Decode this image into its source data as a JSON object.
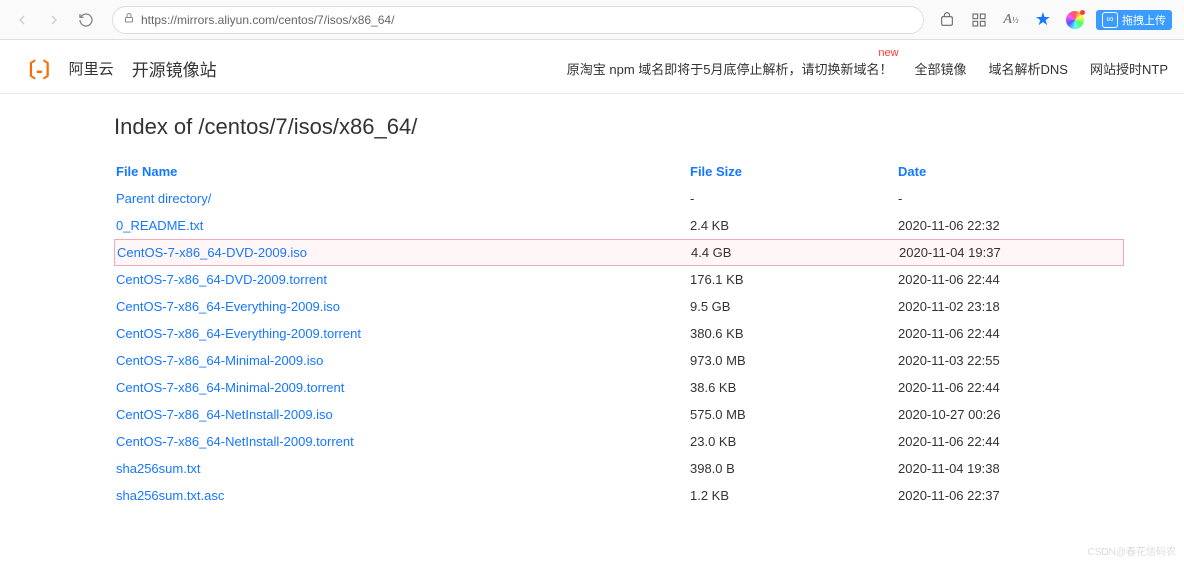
{
  "browser": {
    "url": "https://mirrors.aliyun.com/centos/7/isos/x86_64/",
    "ext_label": "拖拽上传"
  },
  "header": {
    "logo_text": "阿里云",
    "site_title": "开源镜像站",
    "notice": "原淘宝 npm 域名即将于5月底停止解析，请切换新域名！",
    "notice_badge": "new",
    "nav": {
      "all_mirrors": "全部镜像",
      "dns": "域名解析DNS",
      "ntp": "网站授时NTP"
    }
  },
  "page": {
    "title": "Index of /centos/7/isos/x86_64/",
    "columns": {
      "name": "File Name",
      "size": "File Size",
      "date": "Date"
    },
    "rows": [
      {
        "name": "Parent directory/",
        "size": "-",
        "date": "-",
        "hl": false
      },
      {
        "name": "0_README.txt",
        "size": "2.4 KB",
        "date": "2020-11-06 22:32",
        "hl": false
      },
      {
        "name": "CentOS-7-x86_64-DVD-2009.iso",
        "size": "4.4 GB",
        "date": "2020-11-04 19:37",
        "hl": true
      },
      {
        "name": "CentOS-7-x86_64-DVD-2009.torrent",
        "size": "176.1 KB",
        "date": "2020-11-06 22:44",
        "hl": false
      },
      {
        "name": "CentOS-7-x86_64-Everything-2009.iso",
        "size": "9.5 GB",
        "date": "2020-11-02 23:18",
        "hl": false
      },
      {
        "name": "CentOS-7-x86_64-Everything-2009.torrent",
        "size": "380.6 KB",
        "date": "2020-11-06 22:44",
        "hl": false
      },
      {
        "name": "CentOS-7-x86_64-Minimal-2009.iso",
        "size": "973.0 MB",
        "date": "2020-11-03 22:55",
        "hl": false
      },
      {
        "name": "CentOS-7-x86_64-Minimal-2009.torrent",
        "size": "38.6 KB",
        "date": "2020-11-06 22:44",
        "hl": false
      },
      {
        "name": "CentOS-7-x86_64-NetInstall-2009.iso",
        "size": "575.0 MB",
        "date": "2020-10-27 00:26",
        "hl": false
      },
      {
        "name": "CentOS-7-x86_64-NetInstall-2009.torrent",
        "size": "23.0 KB",
        "date": "2020-11-06 22:44",
        "hl": false
      },
      {
        "name": "sha256sum.txt",
        "size": "398.0 B",
        "date": "2020-11-04 19:38",
        "hl": false
      },
      {
        "name": "sha256sum.txt.asc",
        "size": "1.2 KB",
        "date": "2020-11-06 22:37",
        "hl": false
      }
    ]
  },
  "watermark": "CSDN@春花信码农"
}
